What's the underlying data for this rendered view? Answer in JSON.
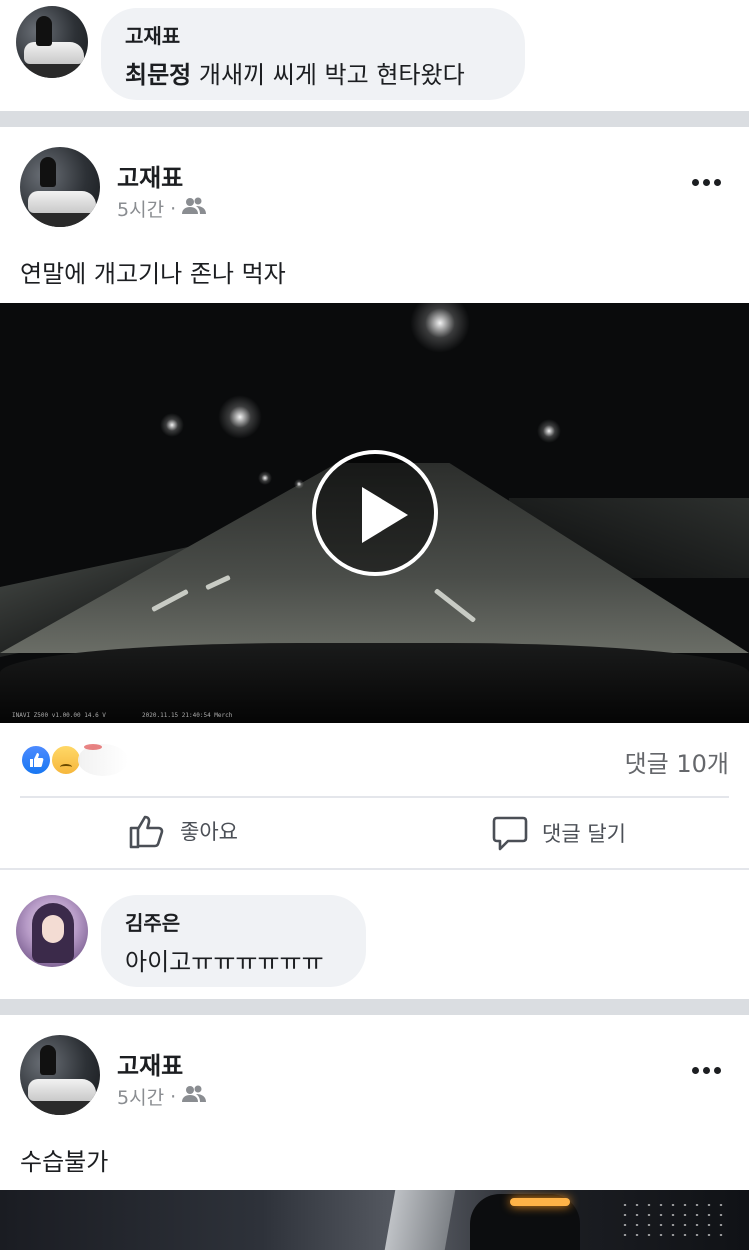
{
  "top_comment": {
    "author": "고재표",
    "mention": "최문정",
    "text": " 개새끼 씨게 박고 현타왔다"
  },
  "post1": {
    "author": "고재표",
    "time": "5시간",
    "dot": "·",
    "privacy_icon": "friends-icon",
    "text": "연말에 개고기나 존나 먹자",
    "video": {
      "osd_left": "INAVI Z500  v1.00.00  14.6 V",
      "osd_mid": "2020.11.15 21:40:54  Merch"
    },
    "reactions": [
      "like",
      "sad"
    ],
    "comment_count": "댓글 10개",
    "like_label": "좋아요",
    "comment_label": "댓글 달기"
  },
  "reply_comment": {
    "author": "김주은",
    "text": "아이고ㅠㅠㅠㅠㅠㅠ"
  },
  "post2": {
    "author": "고재표",
    "time": "5시간",
    "dot": "·",
    "privacy_icon": "friends-icon",
    "text": "수습불가"
  },
  "colors": {
    "bubble_bg": "#f0f2f5",
    "separator": "#dadde1",
    "like_blue": "#1877f2",
    "meta_gray": "#8a8d91"
  }
}
